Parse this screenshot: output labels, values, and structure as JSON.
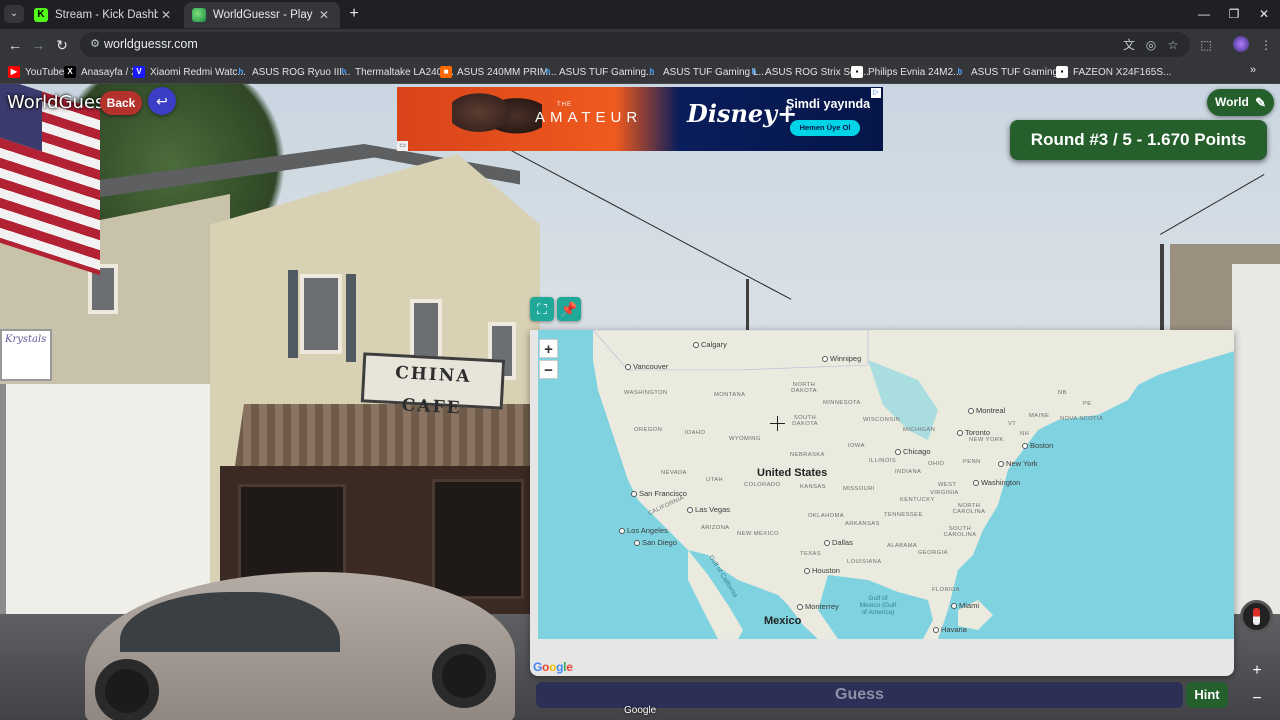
{
  "browser": {
    "tabs": [
      {
        "title": "Stream - Kick Dashboard",
        "favicon": "kick-icon",
        "active": false
      },
      {
        "title": "WorldGuessr - Play Geoguessr Free",
        "favicon": "worldguessr-icon",
        "active": true
      }
    ],
    "url": "worldguessr.com",
    "bookmarks": [
      {
        "label": "YouTube",
        "icon": "youtube-icon"
      },
      {
        "label": "Anasayfa / X",
        "icon": "x-icon"
      },
      {
        "label": "Xiaomi Redmi Watc...",
        "icon": "v-icon"
      },
      {
        "label": "ASUS ROG Ryuo III...",
        "icon": "h-icon"
      },
      {
        "label": "Thermaltake LA240-...",
        "icon": "h-icon"
      },
      {
        "label": "ASUS 240MM PRIM...",
        "icon": "orange-icon"
      },
      {
        "label": "ASUS TUF Gaming...",
        "icon": "h-icon"
      },
      {
        "label": "ASUS TUF Gaming L...",
        "icon": "h-icon"
      },
      {
        "label": "ASUS ROG Strix Sco...",
        "icon": "h-icon"
      },
      {
        "label": "Philips Evnia 24M2...",
        "icon": "ph-icon"
      },
      {
        "label": "ASUS TUF Gaming...",
        "icon": "h-icon"
      },
      {
        "label": "FAZEON X24F165S...",
        "icon": "ph-icon"
      }
    ]
  },
  "game": {
    "brand": "WorldGuessr",
    "back_label": "Back",
    "world_label": "World",
    "round_text": "Round #3 / 5 - 1.670 Points",
    "guess_label": "Guess",
    "hint_label": "Hint",
    "footer_google": "Google",
    "accent_green": "#245f2c",
    "back_red": "#b3322c"
  },
  "scene": {
    "shop_sign_left": "Krystals",
    "china_sign": "CHINA CAFE"
  },
  "ad": {
    "title": "AMATEUR",
    "title_prefix": "THE",
    "brand": "Disney+",
    "headline": "Şimdi yayında",
    "cta": "Hemen Üye Ol"
  },
  "map": {
    "country_labels": [
      "United States",
      "Mexico"
    ],
    "cities": [
      "Calgary",
      "Winnipeg",
      "Vancouver",
      "Montreal",
      "Toronto",
      "Boston",
      "Chicago",
      "New York",
      "Washington",
      "San Francisco",
      "Las Vegas",
      "Los Angeles",
      "San Diego",
      "Dallas",
      "Houston",
      "Monterrey",
      "Miami",
      "Havana"
    ],
    "states": [
      "WASHINGTON",
      "MONTANA",
      "NORTH DAKOTA",
      "MINNESOTA",
      "OREGON",
      "IDAHO",
      "WYOMING",
      "SOUTH DAKOTA",
      "WISCONSIN",
      "MICHIGAN",
      "NEBRASKA",
      "IOWA",
      "NEVADA",
      "UTAH",
      "COLORADO",
      "KANSAS",
      "ILLINOIS",
      "INDIANA",
      "OHIO",
      "PENN",
      "CALIFORNIA",
      "ARIZONA",
      "NEW MEXICO",
      "OKLAHOMA",
      "MISSOURI",
      "KENTUCKY",
      "TENNESSEE",
      "ARKANSAS",
      "TEXAS",
      "LOUISIANA",
      "ALABAMA",
      "GEORGIA",
      "NORTH CAROLINA",
      "SOUTH CAROLINA",
      "FLORIDA",
      "NEW YORK",
      "MAINE",
      "VT",
      "NH",
      "NB",
      "PE",
      "NOVA SCOTIA",
      "WEST",
      "VIRGINIA"
    ],
    "water": [
      "Gulf of California",
      "Gulf of Mexico (Gulf of America)"
    ],
    "zoom_in": "+",
    "zoom_out": "−"
  }
}
